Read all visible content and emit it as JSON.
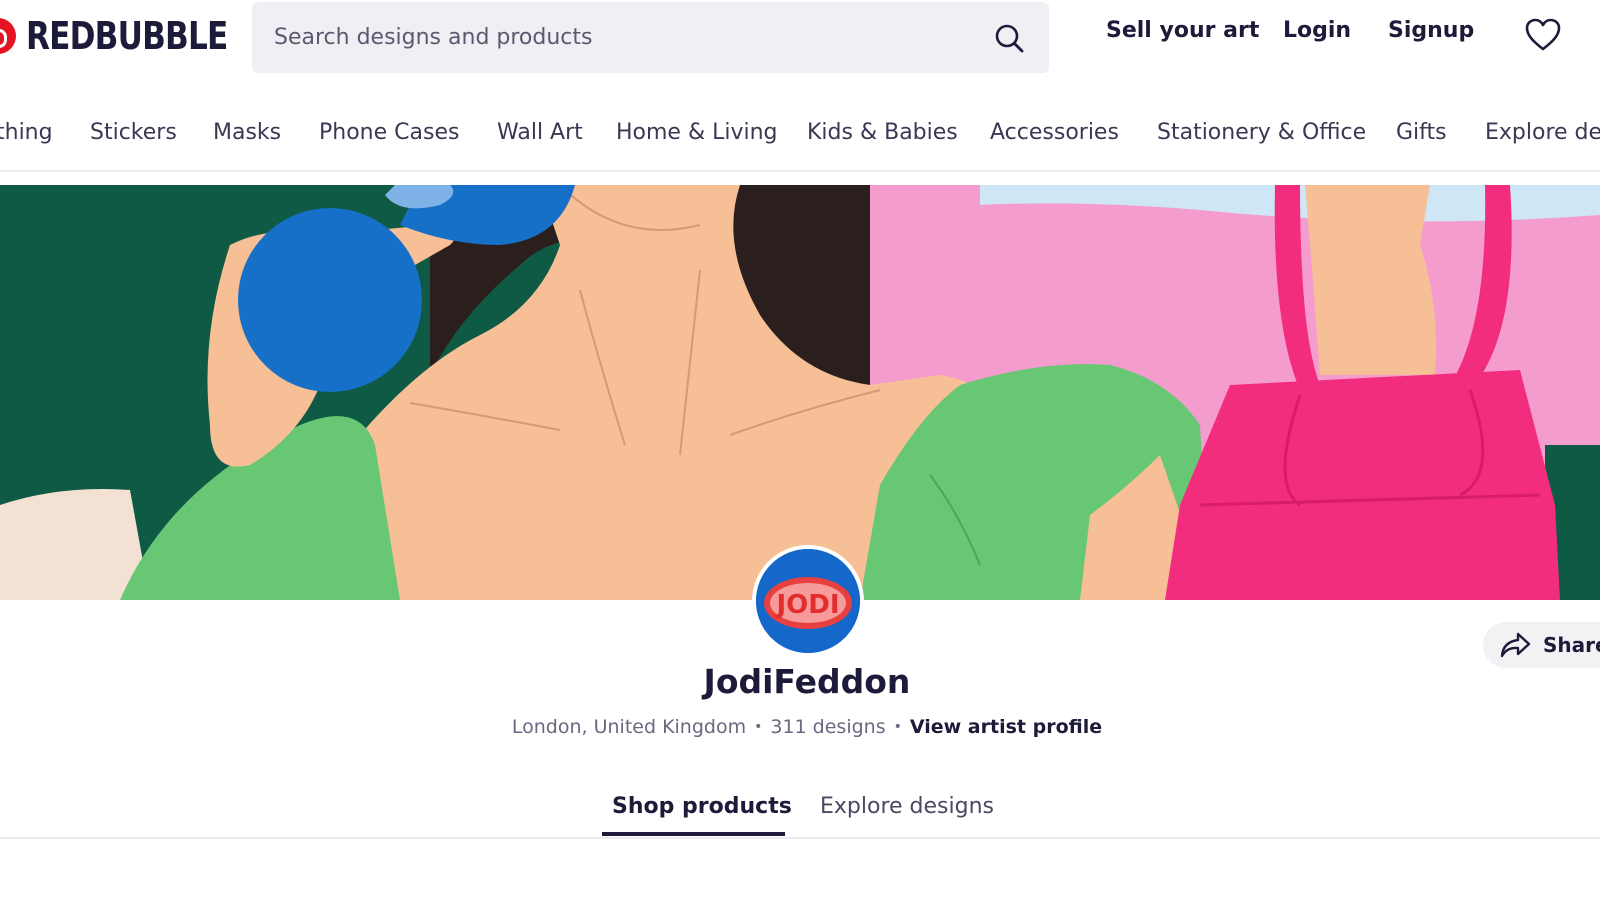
{
  "header": {
    "logo_text": "REDBUBBLE",
    "search_placeholder": "Search designs and products",
    "sell_label": "Sell your art",
    "login_label": "Login",
    "signup_label": "Signup"
  },
  "categories": [
    {
      "label": "thing"
    },
    {
      "label": "Stickers"
    },
    {
      "label": "Masks"
    },
    {
      "label": "Phone Cases"
    },
    {
      "label": "Wall Art"
    },
    {
      "label": "Home & Living"
    },
    {
      "label": "Kids & Babies"
    },
    {
      "label": "Accessories"
    },
    {
      "label": "Stationery & Office"
    },
    {
      "label": "Gifts"
    },
    {
      "label": "Explore des"
    }
  ],
  "profile": {
    "avatar_text": "JODI",
    "name": "JodiFeddon",
    "location": "London, United Kingdom",
    "designs_count": "311 designs",
    "view_profile_label": "View artist profile",
    "share_label": "Share"
  },
  "tabs": {
    "active": "Shop products",
    "other": "Explore designs"
  },
  "colors": {
    "brand_red": "#e41321",
    "text_dark": "#1d1b3a",
    "banner_green_dark": "#0e5a45",
    "banner_pink": "#f59ccf",
    "banner_blue": "#1670c8",
    "banner_skin": "#f7bf95",
    "banner_bag": "#f22d7d",
    "banner_green_light": "#67c774"
  },
  "icons": [
    "search-icon",
    "heart-icon",
    "share-icon"
  ]
}
